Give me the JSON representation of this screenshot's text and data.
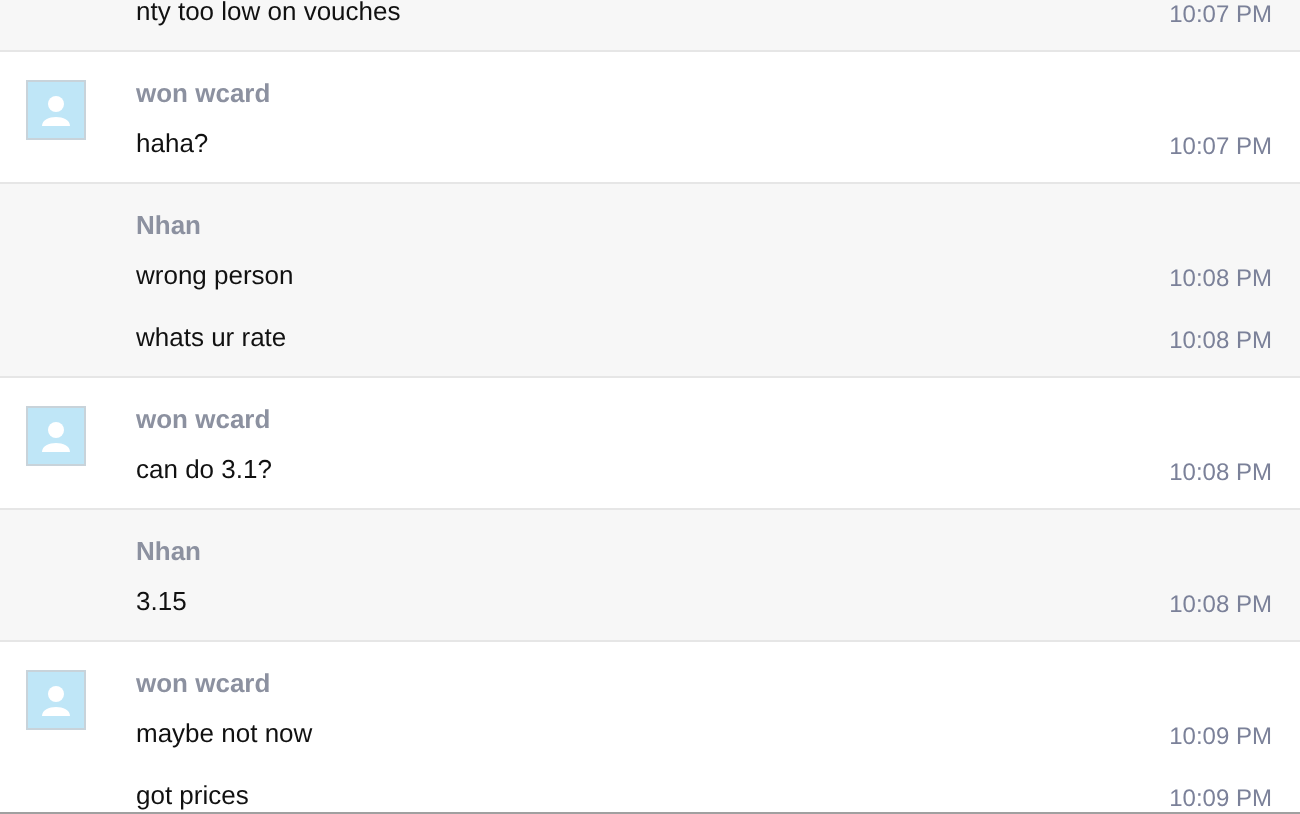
{
  "groups": [
    {
      "avatar": false,
      "messages": [
        {
          "text": "nty too low on vouches",
          "time": "10:07 PM"
        }
      ]
    },
    {
      "sender": "won wcard",
      "avatar": true,
      "messages": [
        {
          "text": "haha?",
          "time": "10:07 PM"
        }
      ]
    },
    {
      "sender": "Nhan",
      "avatar": false,
      "messages": [
        {
          "text": "wrong person",
          "time": "10:08 PM"
        },
        {
          "text": "whats ur rate",
          "time": "10:08 PM"
        }
      ]
    },
    {
      "sender": "won wcard",
      "avatar": true,
      "messages": [
        {
          "text": "can do 3.1?",
          "time": "10:08 PM"
        }
      ]
    },
    {
      "sender": "Nhan",
      "avatar": false,
      "messages": [
        {
          "text": "3.15",
          "time": "10:08 PM"
        }
      ]
    },
    {
      "sender": "won wcard",
      "avatar": true,
      "messages": [
        {
          "text": "maybe not now",
          "time": "10:09 PM"
        },
        {
          "text": "got prices",
          "time": "10:09 PM"
        }
      ]
    }
  ]
}
